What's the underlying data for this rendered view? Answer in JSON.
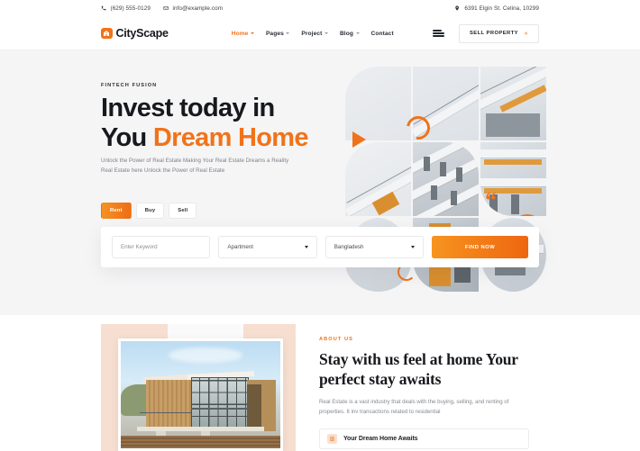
{
  "topbar": {
    "phone": "(629) 555-0129",
    "email": "info@example.com",
    "address": "6391 Elgin St. Celina, 10299",
    "phone_icon": "phone-icon",
    "email_icon": "envelope-icon",
    "location_icon": "map-pin-icon"
  },
  "nav": {
    "logo_text": "CityScape",
    "logo_icon": "house-icon",
    "menu": [
      {
        "label": "Home",
        "has_caret": true,
        "active": true
      },
      {
        "label": "Pages",
        "has_caret": true,
        "active": false
      },
      {
        "label": "Project",
        "has_caret": true,
        "active": false
      },
      {
        "label": "Blog",
        "has_caret": true,
        "active": false
      },
      {
        "label": "Contact",
        "has_caret": false,
        "active": false
      }
    ],
    "menu_icon": "hamburger-menu-icon",
    "sell_label": "SELL PROPERTY",
    "sell_arrow_icon": "arrow-right-icon"
  },
  "hero": {
    "eyebrow": "FINTECH FUSION",
    "title_line1": "Invest today in",
    "title_line2_plain": "You ",
    "title_line2_accent": "Dream Home",
    "paragraph": "Unlock the Power of Real Estate Making Your Real Estate Dreams a Reality Real Estate here Unlock the Power of Real Estate",
    "tabs": [
      {
        "label": "Rent",
        "active": true
      },
      {
        "label": "Buy",
        "active": false
      },
      {
        "label": "Sell",
        "active": false
      }
    ],
    "search": {
      "keyword_placeholder": "Enter Keyword",
      "keyword_value": "",
      "property_type": "Apartment",
      "location": "Bangladesh",
      "submit_label": "FIND NOW"
    },
    "play_icon": "play-triangle-icon",
    "quote_glyph": "“"
  },
  "about": {
    "eyebrow": "ABOUT US",
    "heading": "Stay with us feel at home Your perfect stay awaits",
    "paragraph": "Real Estate is a vast industry that deals with the buying, selling, and renting of properties. It inv transactions related to residential",
    "accordion": {
      "label": "Your Dream Home Awaits",
      "icon": "building-icon"
    }
  },
  "colors": {
    "accent": "#f0731a",
    "accent_light": "#f59322",
    "dark": "#17191d",
    "muted": "#86898f",
    "hero_bg": "#f5f5f6",
    "peach": "#f6ded0"
  }
}
